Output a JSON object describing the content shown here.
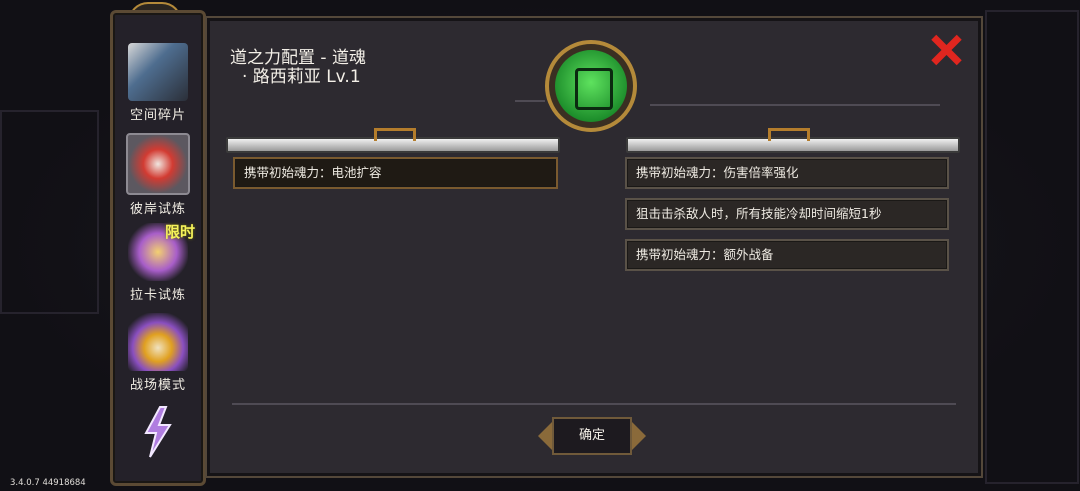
{
  "sidebar": {
    "items": [
      {
        "label": "空间碎片",
        "icon": "space-fragment-icon"
      },
      {
        "label": "彼岸试炼",
        "icon": "red-flower-icon"
      },
      {
        "label": "拉卡试炼",
        "icon": "raka-crest-icon",
        "badge": "限时"
      },
      {
        "label": "战场模式",
        "icon": "wizard-icon"
      },
      {
        "label": "",
        "icon": "lightning-icon"
      }
    ]
  },
  "dialog": {
    "title_line1": "道之力配置 - 道魂",
    "title_line2": "· 路西莉亚 Lv.1",
    "emblem_icon": "green-rune-emblem-icon",
    "left_entries": [
      "携带初始魂力：电池扩容"
    ],
    "right_entries": [
      "携带初始魂力：伤害倍率强化",
      "狙击击杀敌人时，所有技能冷却时间缩短1秒",
      "携带初始魂力：额外战备"
    ],
    "confirm_label": "确定"
  },
  "version": "3.4.0.7 44918684",
  "colors": {
    "close": "#e0261f",
    "accent": "#b48a3a",
    "emblem": "#3fc94a",
    "limited": "#f5f25a"
  }
}
